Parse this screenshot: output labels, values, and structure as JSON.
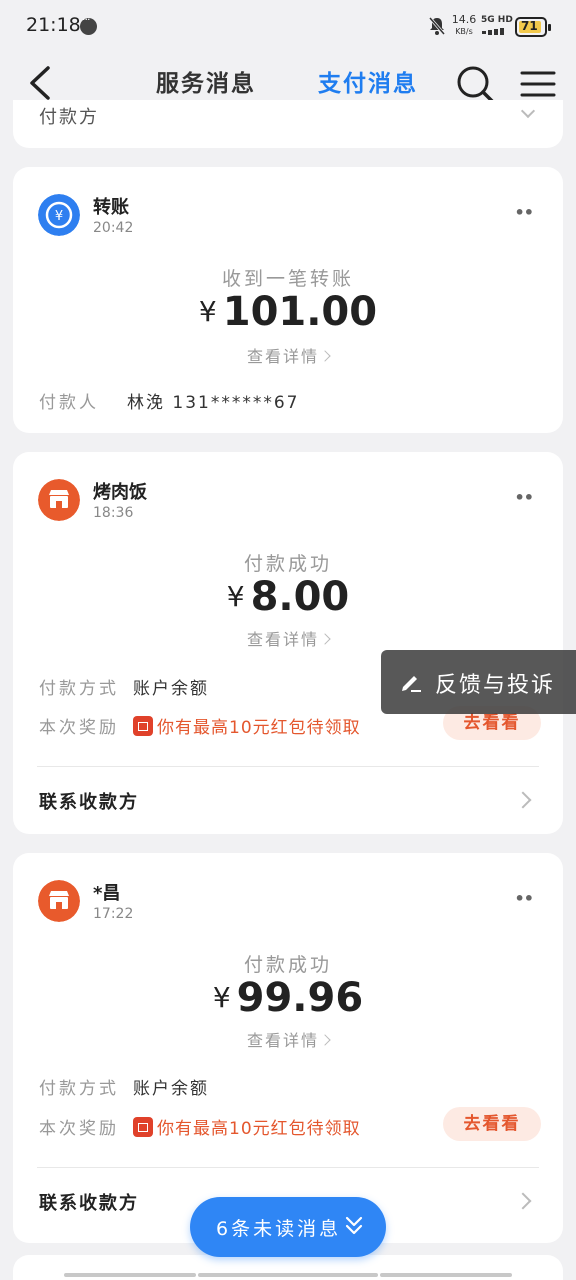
{
  "status_bar": {
    "time": "21:18",
    "net_speed": "14.6",
    "net_unit": "KB/s",
    "network": "5G HD",
    "battery": "71",
    "colors": {
      "battery_fill": "#f2c94c"
    }
  },
  "nav": {
    "tabs": [
      {
        "label": "服务消息",
        "active": false
      },
      {
        "label": "支付消息",
        "active": true
      }
    ],
    "accent_color": "#1f7df0"
  },
  "previous_card_peek": "付款方",
  "cards": [
    {
      "icon": "transfer-yen-icon",
      "title": "转账",
      "time": "20:42",
      "status": "收到一笔转账",
      "currency": "¥",
      "amount": "101.00",
      "detail_link": "查看详情",
      "payer_label": "付款人",
      "payer_value": "林浼 131******67"
    },
    {
      "icon": "shop-icon",
      "title": "烤肉饭",
      "time": "18:36",
      "status": "付款成功",
      "currency": "¥",
      "amount": "8.00",
      "detail_link": "查看详情",
      "method_label": "付款方式",
      "method_value": "账户余额",
      "reward_label": "本次奖励",
      "reward_text": "你有最高10元红包待领取",
      "reward_button": "去看看",
      "contact": "联系收款方"
    },
    {
      "icon": "shop-icon",
      "title": "*昌",
      "time": "17:22",
      "status": "付款成功",
      "currency": "¥",
      "amount": "99.96",
      "detail_link": "查看详情",
      "method_label": "付款方式",
      "method_value": "账户余额",
      "reward_label": "本次奖励",
      "reward_text": "你有最高10元红包待领取",
      "reward_button": "去看看",
      "contact": "联系收款方"
    }
  ],
  "feedback_button": "反馈与投诉",
  "unread_button": "6条未读消息"
}
